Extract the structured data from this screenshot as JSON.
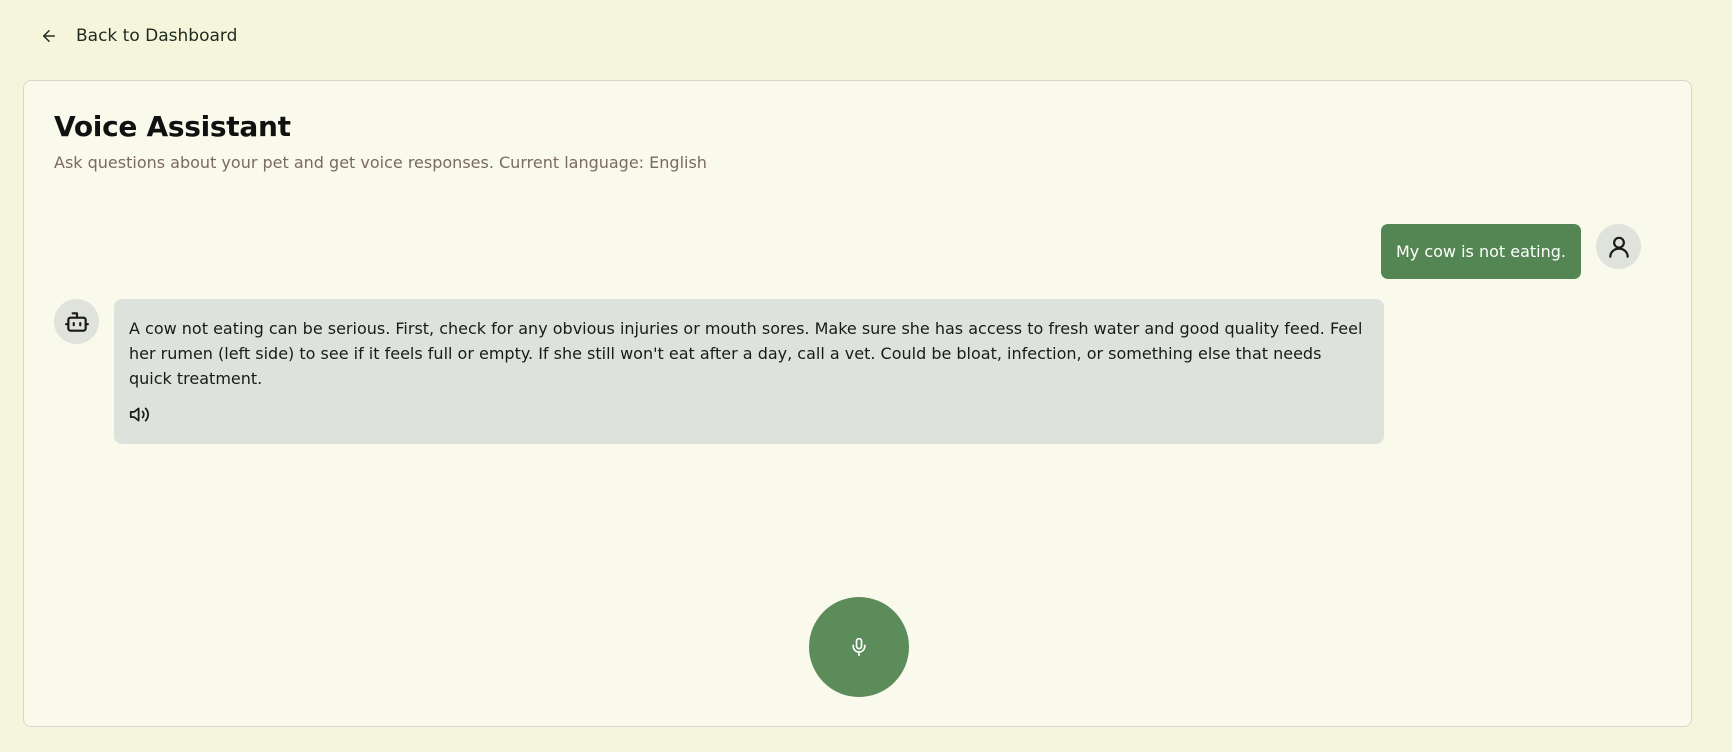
{
  "nav": {
    "back_label": "Back to Dashboard",
    "back_icon": "arrow-left-icon"
  },
  "header": {
    "title": "Voice Assistant",
    "subtitle": "Ask questions about your pet and get voice responses. Current language: English"
  },
  "messages": [
    {
      "role": "user",
      "text": "My cow is not eating.",
      "avatar_icon": "user-icon"
    },
    {
      "role": "assistant",
      "text": "A cow not eating can be serious. First, check for any obvious injuries or mouth sores. Make sure she has access to fresh water and good quality feed. Feel her rumen (left side) to see if it feels full or empty. If she still won't eat after a day, call a vet. Could be bloat, infection, or something else that needs quick treatment.",
      "avatar_icon": "bot-icon",
      "action_icon": "speaker-icon"
    }
  ],
  "controls": {
    "mic_icon": "microphone-icon"
  },
  "colors": {
    "background": "#f5f5dc",
    "card": "#f9f9ec",
    "user_bubble": "#548653",
    "bot_bubble": "#dde3dc",
    "mic_button": "#5b8c5a",
    "subtitle": "#7a6a60"
  }
}
